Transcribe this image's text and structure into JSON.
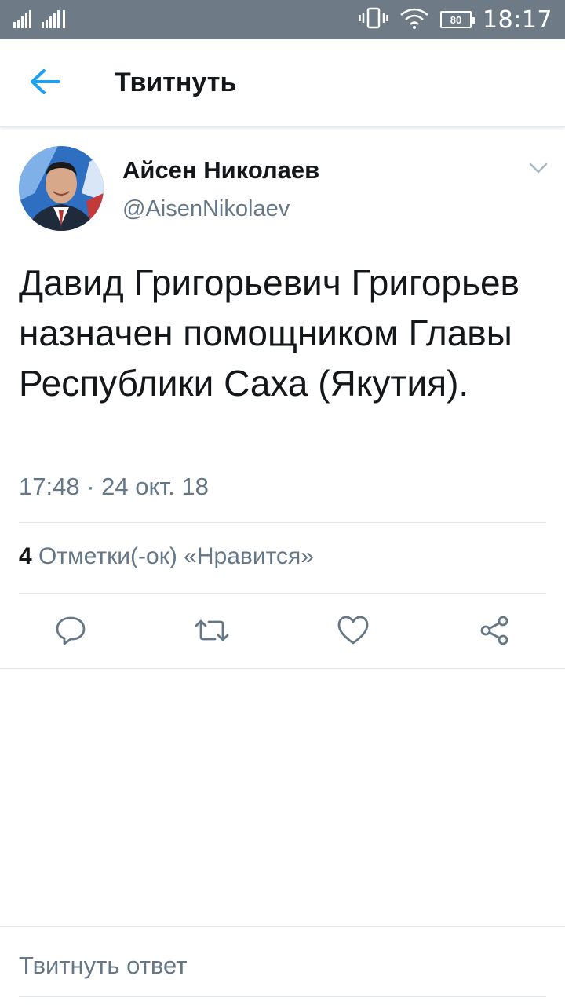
{
  "status_bar": {
    "time": "18:17",
    "battery": "80",
    "icons": [
      "signal-icon",
      "signal-icon",
      "vibrate-icon",
      "wifi-icon",
      "battery-icon"
    ]
  },
  "app_bar": {
    "title": "Твитнуть",
    "back_icon": "arrow-left-icon"
  },
  "tweet": {
    "author_name": "Айсен Николаев",
    "author_handle": "@AisenNikolaev",
    "text": "Давид Григорьевич Григорьев назначен помощником Главы Республики Саха (Якутия).",
    "timestamp": "17:48 · 24 окт. 18",
    "likes_count": "4",
    "likes_label": "Отметки(-ок) «Нравится»",
    "actions": [
      "reply-icon",
      "retweet-icon",
      "like-icon",
      "share-icon"
    ]
  },
  "reply": {
    "placeholder": "Твитнуть ответ"
  },
  "colors": {
    "accent": "#1da1f2",
    "status_bar": "#6e7b87",
    "secondary_text": "#657786",
    "divider": "#e1e8ed"
  }
}
